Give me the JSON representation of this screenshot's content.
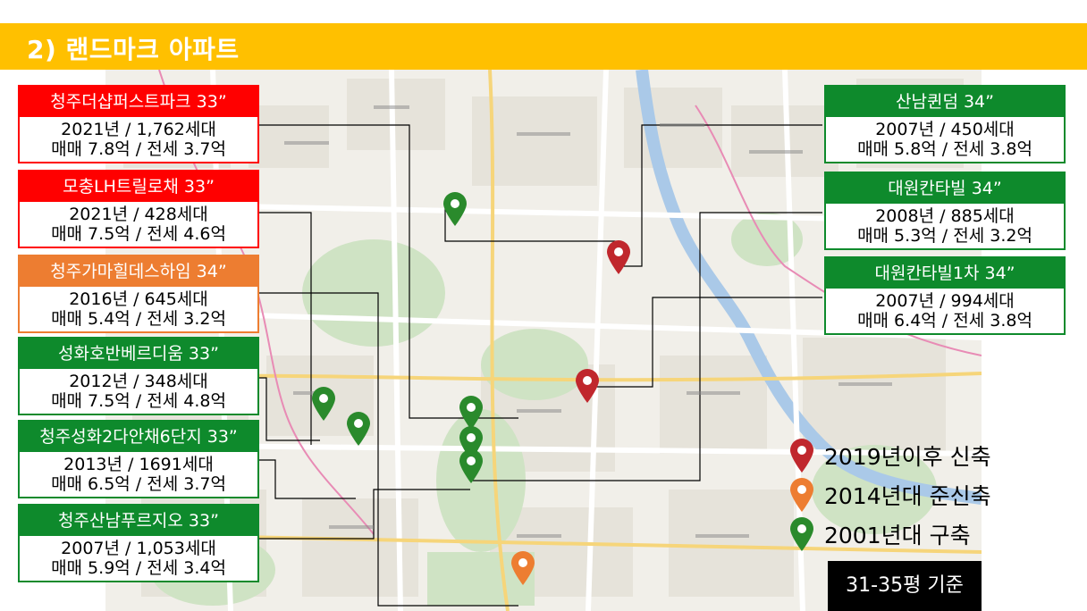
{
  "header": {
    "title": "2) 랜드마크 아파트"
  },
  "colors": {
    "header": "#FFC000",
    "new": "#C0272D",
    "semi_new": "#ED7D31",
    "old": "#2A8A2C",
    "card_red": "#FF0000",
    "card_green": "#0E8A2C"
  },
  "left_cards": [
    {
      "title": "청주더샵퍼스트파크 33”",
      "line1": "2021년 / 1,762세대",
      "line2": "매매 7.8억 / 전세 3.7억",
      "color": "red"
    },
    {
      "title": "모충LH트릴로채 33”",
      "line1": "2021년 / 428세대",
      "line2": "매매 7.5억 / 전세 4.6억",
      "color": "red"
    },
    {
      "title": "청주가마힐데스하임 34”",
      "line1": "2016년 / 645세대",
      "line2": "매매 5.4억 / 전세 3.2억",
      "color": "orange"
    },
    {
      "title": "성화호반베르디움 33”",
      "line1": "2012년 / 348세대",
      "line2": "매매 7.5억 / 전세 4.8억",
      "color": "green"
    },
    {
      "title": "청주성화2다안채6단지 33”",
      "line1": "2013년 / 1691세대",
      "line2": "매매 6.5억 / 전세 3.7억",
      "color": "green"
    },
    {
      "title": "청주산남푸르지오 33”",
      "line1": "2007년 / 1,053세대",
      "line2": "매매 5.9억 / 전세 3.4억",
      "color": "green"
    }
  ],
  "right_cards": [
    {
      "title": "산남퀸덤 34”",
      "line1": "2007년 / 450세대",
      "line2": "매매 5.8억 / 전세 3.8억",
      "color": "green"
    },
    {
      "title": "대원칸타빌 34”",
      "line1": "2008년 / 885세대",
      "line2": "매매 5.3억 / 전세 3.2억",
      "color": "green"
    },
    {
      "title": "대원칸타빌1차 34”",
      "line1": "2007년 / 994세대",
      "line2": "매매 6.4억 / 전세 3.8억",
      "color": "green"
    }
  ],
  "legend": [
    {
      "label": "2019년이후 신축",
      "color": "#C0272D",
      "icon": "map-pin-red-icon"
    },
    {
      "label": "2014년대 준신축",
      "color": "#ED7D31",
      "icon": "map-pin-orange-icon"
    },
    {
      "label": "2001년대 구축",
      "color": "#2A8A2C",
      "icon": "map-pin-green-icon"
    }
  ],
  "basis_label": "31-35평 기준"
}
